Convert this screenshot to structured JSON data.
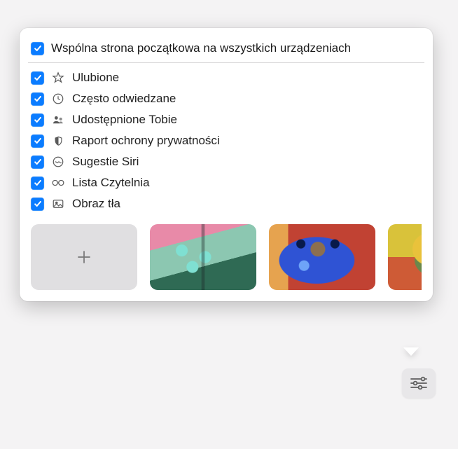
{
  "header": {
    "label": "Wspólna strona początkowa na wszystkich urządzeniach",
    "checked": true
  },
  "options": [
    {
      "icon": "star",
      "label": "Ulubione",
      "checked": true
    },
    {
      "icon": "clock",
      "label": "Często odwiedzane",
      "checked": true
    },
    {
      "icon": "people",
      "label": "Udostępnione Tobie",
      "checked": true
    },
    {
      "icon": "shield",
      "label": "Raport ochrony prywatności",
      "checked": true
    },
    {
      "icon": "siri",
      "label": "Sugestie Siri",
      "checked": true
    },
    {
      "icon": "glasses",
      "label": "Lista Czytelnia",
      "checked": true
    },
    {
      "icon": "image",
      "label": "Obraz tła",
      "checked": true
    }
  ],
  "thumbnails": {
    "add": true,
    "count": 3
  }
}
